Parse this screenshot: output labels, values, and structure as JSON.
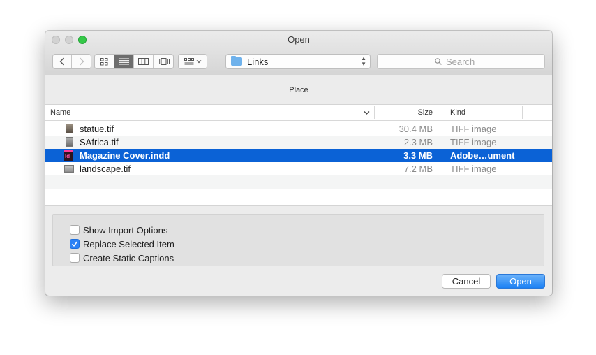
{
  "window": {
    "title": "Open"
  },
  "toolbar": {
    "back_icon": "chevron-left-icon",
    "forward_icon": "chevron-right-icon",
    "view_modes": [
      "icon-view",
      "list-view",
      "column-view",
      "cover-flow-view"
    ],
    "active_view": "list-view",
    "arrange_icon": "arrange-grid-icon",
    "path_label": "Links",
    "search_placeholder": "Search"
  },
  "header": {
    "title": "Place"
  },
  "table": {
    "columns": {
      "name": "Name",
      "size": "Size",
      "kind": "Kind"
    },
    "rows": [
      {
        "name": "statue.tif",
        "size": "30.4 MB",
        "kind": "TIFF image",
        "icon": "tiff-file-icon"
      },
      {
        "name": "SAfrica.tif",
        "size": "2.3 MB",
        "kind": "TIFF image",
        "icon": "tiff-file-icon"
      },
      {
        "name": "Magazine Cover.indd",
        "size": "3.3 MB",
        "kind": "Adobe…ument",
        "icon": "indesign-file-icon",
        "icon_text": "Id",
        "selected": true
      },
      {
        "name": "landscape.tif",
        "size": "7.2 MB",
        "kind": "TIFF image",
        "icon": "tiff-file-icon"
      }
    ]
  },
  "options": [
    {
      "label": "Show Import Options",
      "checked": false
    },
    {
      "label": "Replace Selected Item",
      "checked": true
    },
    {
      "label": "Create Static Captions",
      "checked": false
    }
  ],
  "buttons": {
    "cancel": "Cancel",
    "open": "Open"
  },
  "colors": {
    "selection": "#0b62d6",
    "primary_button": "#1b80f4",
    "checkbox_checked": "#2d82f5",
    "zoom_button": "#35c948"
  }
}
